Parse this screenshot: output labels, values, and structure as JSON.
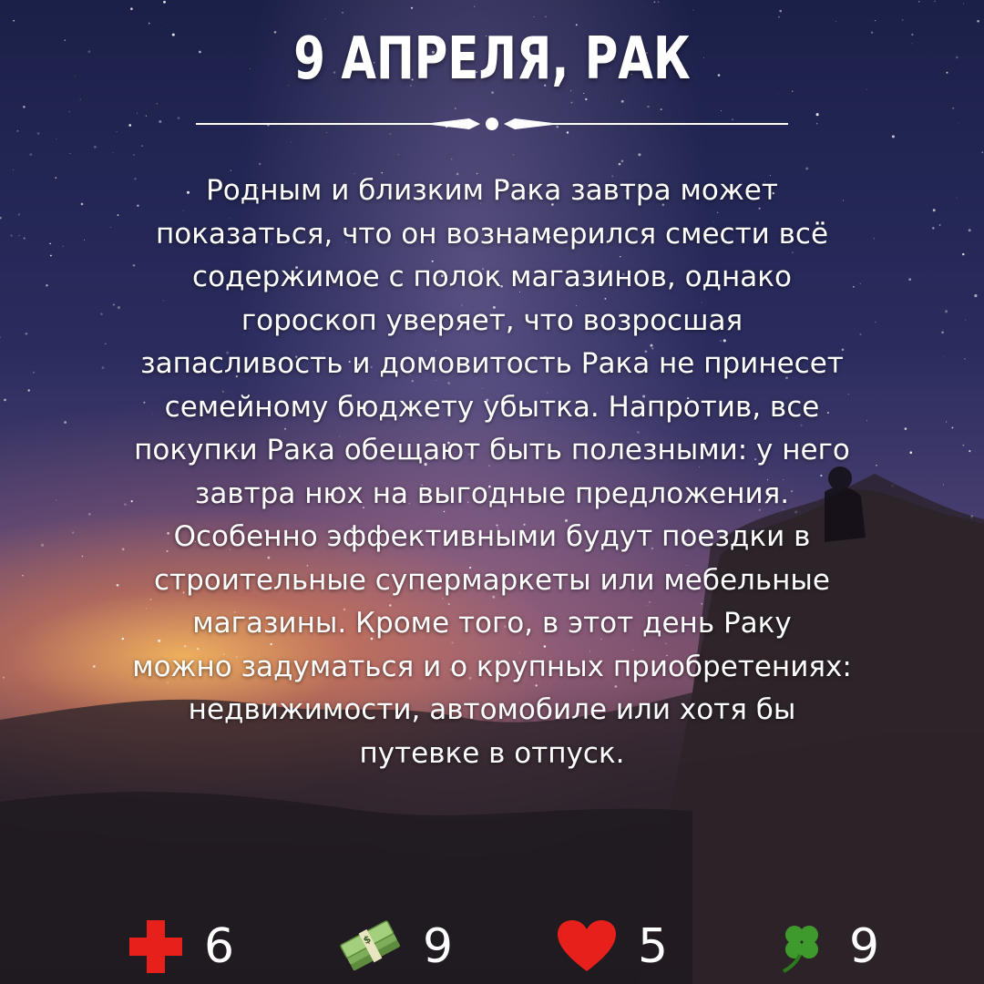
{
  "title": "9 АПРЕЛЯ, РАК",
  "text": "Родным и близким Рака завтра может\nпоказаться, что он вознамерился смести всё\nсодержимое с полок магазинов, однако\nгороскоп уверяет, что возросшая\nзапасливость и домовитость Рака не принесет\nсемейному бюджету убытка. Напротив, все\nпокупки Рака обещают быть полезными: у него\nзавтра нюх на выгодные предложения.\nОсобенно эффективными будут поездки в\nстроительные супермаркеты или мебельные\nмагазины. Кроме того, в этот день Раку\nможно задуматься и о крупных приобретениях:\nнедвижимости, автомобиле или хотя бы\nпутевке в отпуск.",
  "stats": [
    {
      "icon": "red-cross-icon",
      "value": "6",
      "color": "#e8201c"
    },
    {
      "icon": "money-icon",
      "value": "9",
      "color": "#7fae5a"
    },
    {
      "icon": "heart-icon",
      "value": "5",
      "color": "#e8201c"
    },
    {
      "icon": "clover-icon",
      "value": "9",
      "color": "#3f9a2e"
    }
  ]
}
